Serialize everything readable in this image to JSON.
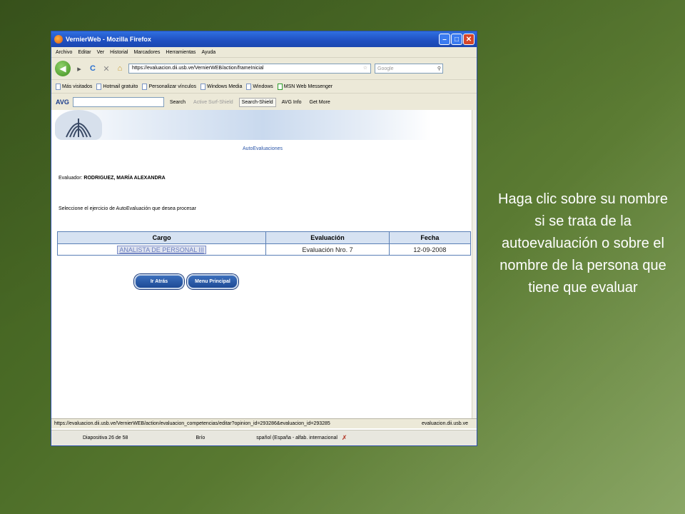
{
  "caption": "Haga clic sobre su nombre si se trata de la autoevaluación o sobre el nombre de la persona que tiene que evaluar",
  "browser": {
    "title": "VernierWeb - Mozilla Firefox",
    "menu": [
      "Archivo",
      "Editar",
      "Ver",
      "Historial",
      "Marcadores",
      "Herramientas",
      "Ayuda"
    ],
    "url": "https://evaluacion.dii.usb.ve/VernierWEB/action/frameInicial",
    "search_placeholder": "Google",
    "bookmarks": [
      "Más visitados",
      "Hotmail gratuito",
      "Personalizar vínculos",
      "Windows Media",
      "Windows",
      "MSN Web Messenger"
    ],
    "avg": {
      "logo": "AVG",
      "search": "Search",
      "active_surf": "Active Surf-Shield",
      "search_shield": "Search-Shield",
      "avg_info": "AVG Info",
      "get_more": "Get More"
    },
    "status_url": "https://evaluacion.dii.usb.ve/VernierWEB/action/evaluacion_competencias/editar?opinion_id=293286&evaluacion_id=293285",
    "status_host": "evaluacion.dii.usb.ve"
  },
  "page": {
    "heading": "AutoEvaluaciones",
    "evaluador_label": "Evaluador:",
    "evaluador_name": "RODRIGUEZ, MARÍA ALEXANDRA",
    "instruction": "Seleccione el ejercicio de AutoEvaluación que desea procesar",
    "table": {
      "headers": [
        "Cargo",
        "Evaluación",
        "Fecha"
      ],
      "rows": [
        {
          "cargo": "ANALISTA DE PERSONAL III",
          "evaluacion": "Evaluación Nro. 7",
          "fecha": "12-09-2008"
        }
      ]
    },
    "btn_back": "Ir Atrás",
    "btn_menu": "Menu Principal"
  },
  "ppt_status": {
    "slide": "Diapositiva 26 de 58",
    "theme": "Brío",
    "language": "spañol (España - alfab. internacional"
  },
  "colors": {
    "background": "#4a6b26",
    "accent": "#1f4fc0",
    "table_border": "#5a7fb6"
  }
}
